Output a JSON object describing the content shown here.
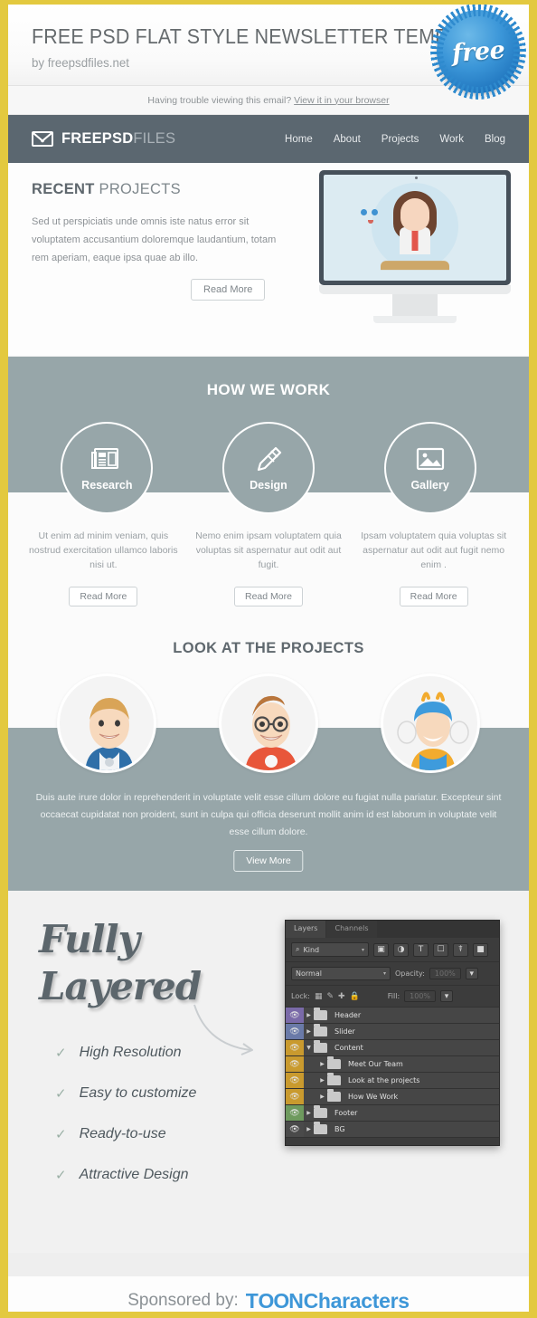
{
  "theme": {
    "border_yellow": "#e3c93f",
    "nav_dark": "#5b6770",
    "slate": "#97a6a9",
    "accent_blue": "#3e97d8",
    "text_gray": "#8d9296"
  },
  "masthead": {
    "title": "FREE PSD FLAT STYLE NEWSLETTER TEMPLATE",
    "subtitle": "by freepsdfiles.net",
    "badge_label": "free"
  },
  "trouble_bar": {
    "text": "Having trouble viewing this email?",
    "link": "View it in your browser"
  },
  "nav": {
    "brand_bold": "FREEPSD",
    "brand_light": "FILES",
    "links": [
      {
        "label": "Home"
      },
      {
        "label": "About"
      },
      {
        "label": "Projects"
      },
      {
        "label": "Work"
      },
      {
        "label": "Blog"
      }
    ]
  },
  "recent": {
    "title_bold": "RECENT",
    "title_light": "PROJECTS",
    "body": "Sed ut perspiciatis unde omnis iste natus error sit voluptatem accusantium doloremque laudantium, totam rem aperiam, eaque ipsa quae ab illo.",
    "button": "Read More"
  },
  "how_we_work": {
    "title": "HOW WE WORK",
    "columns": [
      {
        "caption": "Research",
        "icon": "newspaper-icon",
        "body": "Ut enim ad minim veniam, quis nostrud exercitation ullamco laboris nisi ut.",
        "button": "Read More"
      },
      {
        "caption": "Design",
        "icon": "pen-icon",
        "body": "Nemo enim ipsam voluptatem quia voluptas sit aspernatur aut odit aut fugit.",
        "button": "Read More"
      },
      {
        "caption": "Gallery",
        "icon": "image-icon",
        "body": "Ipsam voluptatem quia voluptas sit aspernatur aut odit aut fugit nemo enim .",
        "button": "Read More"
      }
    ]
  },
  "projects": {
    "title": "LOOK AT THE PROJECTS",
    "avatars": [
      {
        "name": "blue-hero-avatar"
      },
      {
        "name": "red-hero-avatar"
      },
      {
        "name": "yellow-hero-avatar"
      }
    ],
    "body": "Duis aute irure dolor in reprehenderit in voluptate velit esse cillum dolore eu fugiat nulla pariatur. Excepteur sint occaecat cupidatat non proident, sunt in culpa qui officia deserunt mollit anim id est laborum  in voluptate velit esse cillum dolore.",
    "button": "View More"
  },
  "layered": {
    "title_line1": "Fully",
    "title_line2": "Layered",
    "features": [
      {
        "label": "High Resolution"
      },
      {
        "label": "Easy to customize"
      },
      {
        "label": "Ready-to-use"
      },
      {
        "label": "Attractive Design"
      }
    ]
  },
  "photoshop_panel": {
    "tabs": [
      {
        "label": "Layers",
        "active": true
      },
      {
        "label": "Channels",
        "active": false
      }
    ],
    "filter_select": "Kind",
    "filter_icons": [
      "pixel-layer-icon",
      "adjustment-layer-icon",
      "type-layer-icon",
      "shape-layer-icon",
      "smart-object-icon",
      "toggle-filter-icon"
    ],
    "blend_mode": "Normal",
    "opacity_label": "Opacity:",
    "opacity_value": "100%",
    "lock_label": "Lock:",
    "lock_icons": [
      "lock-transparency-icon",
      "lock-image-icon",
      "lock-position-icon",
      "lock-all-icon"
    ],
    "fill_label": "Fill:",
    "fill_value": "100%",
    "layers": [
      {
        "name": "Header",
        "color": "#7a6aa8",
        "indent": 0,
        "expanded": false
      },
      {
        "name": "Slider",
        "color": "#6a7aa8",
        "indent": 0,
        "expanded": false
      },
      {
        "name": "Content",
        "color": "#c99a2e",
        "indent": 0,
        "expanded": true
      },
      {
        "name": "Meet Our Team",
        "color": "#c99a2e",
        "indent": 1,
        "expanded": false
      },
      {
        "name": "Look at the projects",
        "color": "#c99a2e",
        "indent": 1,
        "expanded": false
      },
      {
        "name": "How We Work",
        "color": "#c99a2e",
        "indent": 1,
        "expanded": false
      },
      {
        "name": "Footer",
        "color": "#6e9a5e",
        "indent": 0,
        "expanded": false
      },
      {
        "name": "BG",
        "color": "#4a4a4a",
        "indent": 0,
        "expanded": false
      }
    ]
  },
  "footer": {
    "sponsored_label": "Sponsored by:",
    "brand_part1": "T",
    "brand_oo": "OO",
    "brand_part2": "N",
    "brand_part3": "Characters"
  }
}
